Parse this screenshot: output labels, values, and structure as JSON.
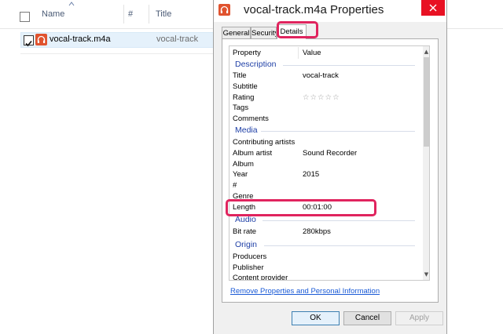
{
  "explorer": {
    "columns": {
      "name": "Name",
      "number": "#",
      "title": "Title"
    },
    "file": {
      "name": "vocal-track.m4a",
      "title": "vocal-track"
    }
  },
  "dialog": {
    "title": "vocal-track.m4a Properties",
    "tabs": [
      {
        "label": "General"
      },
      {
        "label": "Security"
      },
      {
        "label": "Details"
      }
    ],
    "active_tab": "Details",
    "header": {
      "property": "Property",
      "value": "Value"
    },
    "groups": {
      "description": "Description",
      "media": "Media",
      "audio": "Audio",
      "origin": "Origin"
    },
    "rows": {
      "title": {
        "label": "Title",
        "value": "vocal-track"
      },
      "subtitle": {
        "label": "Subtitle",
        "value": ""
      },
      "rating": {
        "label": "Rating",
        "stars": 0
      },
      "tags": {
        "label": "Tags",
        "value": ""
      },
      "comments": {
        "label": "Comments",
        "value": ""
      },
      "contributing_artists": {
        "label": "Contributing artists",
        "value": ""
      },
      "album_artist": {
        "label": "Album artist",
        "value": "Sound Recorder"
      },
      "album": {
        "label": "Album",
        "value": ""
      },
      "year": {
        "label": "Year",
        "value": "2015"
      },
      "number": {
        "label": "#",
        "value": ""
      },
      "genre": {
        "label": "Genre",
        "value": ""
      },
      "length": {
        "label": "Length",
        "value": "00:01:00"
      },
      "bit_rate": {
        "label": "Bit rate",
        "value": "280kbps"
      },
      "producers": {
        "label": "Producers",
        "value": ""
      },
      "publisher": {
        "label": "Publisher",
        "value": ""
      },
      "content_provider": {
        "label": "Content provider",
        "value": ""
      }
    },
    "remove_link": "Remove Properties and Personal Information",
    "buttons": {
      "ok": "OK",
      "cancel": "Cancel",
      "apply": "Apply"
    }
  },
  "icons": {
    "close": "close-icon",
    "app": "headphones-icon",
    "rating_star": "star-outline-icon"
  },
  "colors": {
    "highlight": "#e0245e",
    "app_icon": "#e0532f",
    "close_button": "#e81123",
    "group_label": "#1e3fa6",
    "link": "#1a5ad6"
  }
}
